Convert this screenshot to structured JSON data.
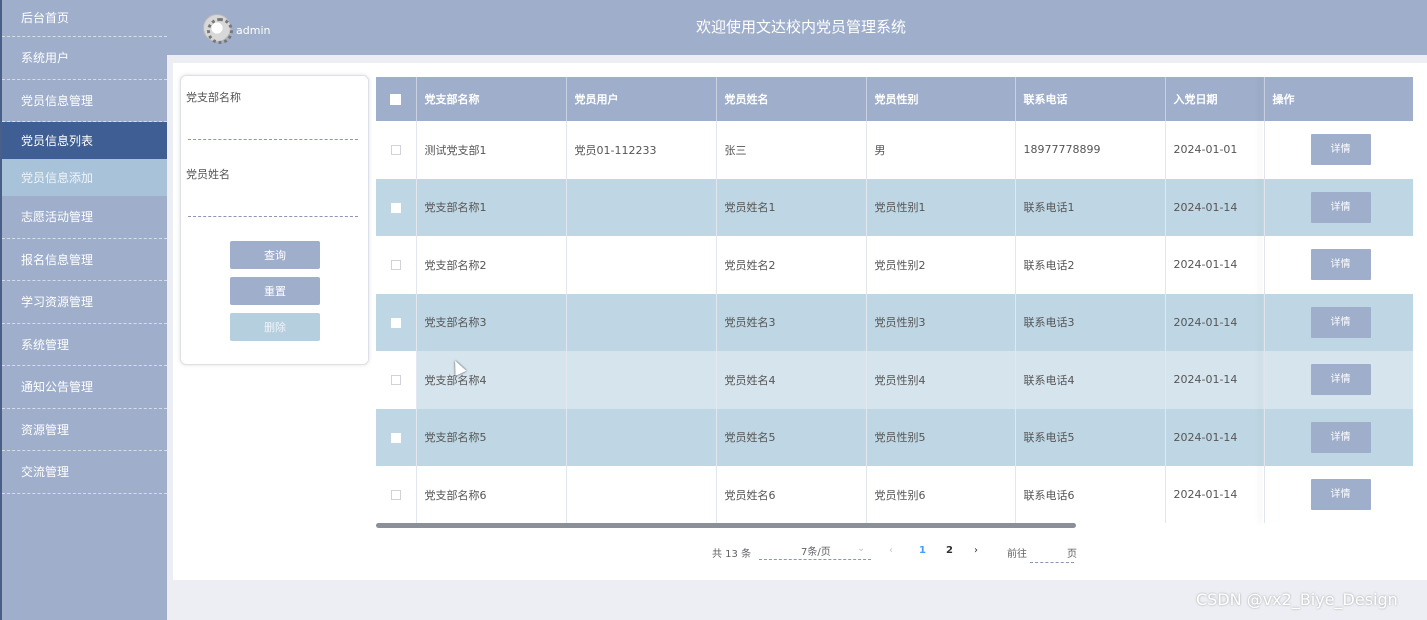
{
  "header": {
    "username": "admin",
    "title": "欢迎使用文达校内党员管理系统"
  },
  "sidebar": {
    "items": [
      {
        "label": "后台首页"
      },
      {
        "label": "系统用户"
      },
      {
        "label": "党员信息管理"
      },
      {
        "label": "党员信息列表",
        "state": "active"
      },
      {
        "label": "党员信息添加",
        "state": "sub"
      },
      {
        "label": "志愿活动管理"
      },
      {
        "label": "报名信息管理"
      },
      {
        "label": "学习资源管理"
      },
      {
        "label": "系统管理"
      },
      {
        "label": "通知公告管理"
      },
      {
        "label": "资源管理"
      },
      {
        "label": "交流管理"
      }
    ]
  },
  "search": {
    "branch_label": "党支部名称",
    "branch_value": "",
    "name_label": "党员姓名",
    "name_value": "",
    "query_btn": "查询",
    "reset_btn": "重置",
    "delete_btn": "删除"
  },
  "table": {
    "columns": [
      "党支部名称",
      "党员用户",
      "党员姓名",
      "党员性别",
      "联系电话",
      "入党日期",
      "操作"
    ],
    "detail_label": "详情",
    "rows": [
      {
        "branch": "测试党支部1",
        "user": "党员01-112233",
        "name": "张三",
        "gender": "男",
        "phone": "18977778899",
        "date": "2024-01-01"
      },
      {
        "branch": "党支部名称1",
        "user": "",
        "name": "党员姓名1",
        "gender": "党员性别1",
        "phone": "联系电话1",
        "date": "2024-01-14"
      },
      {
        "branch": "党支部名称2",
        "user": "",
        "name": "党员姓名2",
        "gender": "党员性别2",
        "phone": "联系电话2",
        "date": "2024-01-14"
      },
      {
        "branch": "党支部名称3",
        "user": "",
        "name": "党员姓名3",
        "gender": "党员性别3",
        "phone": "联系电话3",
        "date": "2024-01-14"
      },
      {
        "branch": "党支部名称4",
        "user": "",
        "name": "党员姓名4",
        "gender": "党员性别4",
        "phone": "联系电话4",
        "date": "2024-01-14"
      },
      {
        "branch": "党支部名称5",
        "user": "",
        "name": "党员姓名5",
        "gender": "党员性别5",
        "phone": "联系电话5",
        "date": "2024-01-14"
      },
      {
        "branch": "党支部名称6",
        "user": "",
        "name": "党员姓名6",
        "gender": "党员性别6",
        "phone": "联系电话6",
        "date": "2024-01-14"
      }
    ]
  },
  "pagination": {
    "total_text": "共 13 条",
    "page_size": "7条/页",
    "pages": [
      "1",
      "2"
    ],
    "current_page": "1",
    "goto_label": "前往",
    "goto_value": "",
    "page_suffix": "页"
  },
  "watermark": "CSDN @vx2_Biye_Design",
  "colors": {
    "sidebar_bg": "#9eaecb",
    "active_item": "#3e5e94",
    "row_highlight": "#bfd7e4",
    "accent": "#409eff"
  }
}
